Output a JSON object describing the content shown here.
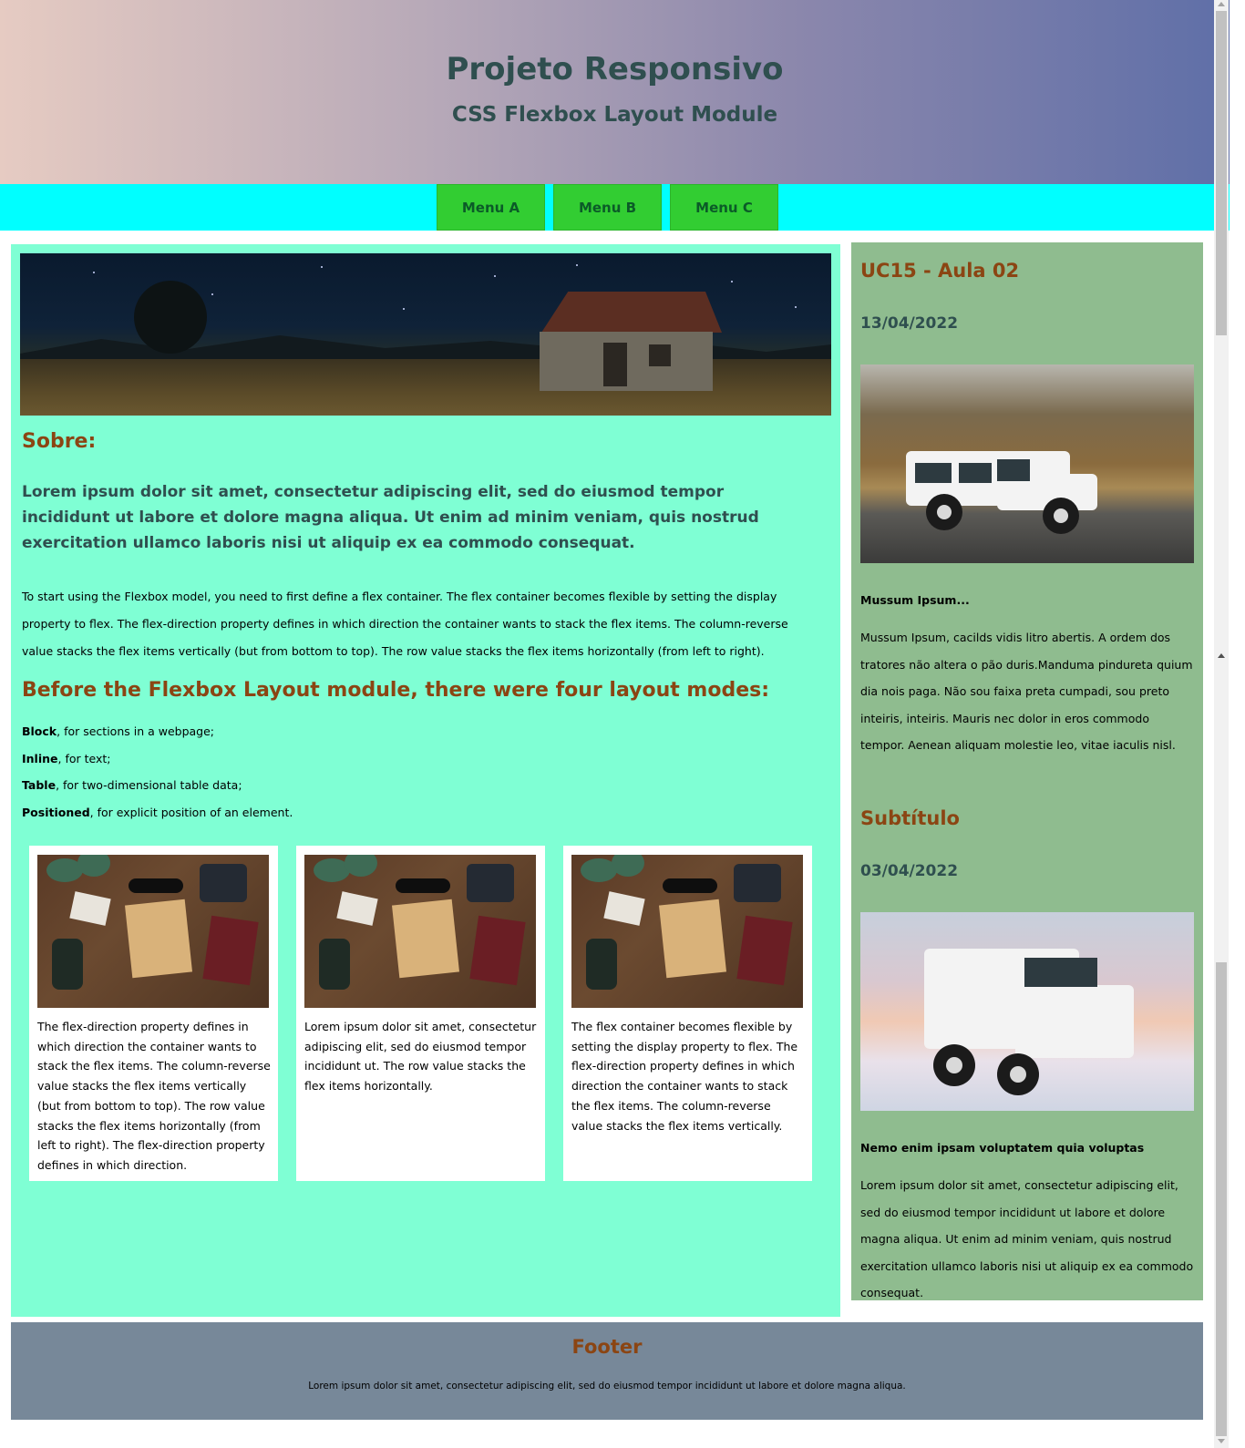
{
  "header": {
    "title": "Projeto Responsivo",
    "subtitle": "CSS Flexbox Layout Module"
  },
  "nav": {
    "items": [
      {
        "label": "Menu A"
      },
      {
        "label": "Menu B"
      },
      {
        "label": "Menu C"
      }
    ]
  },
  "main": {
    "about_heading": "Sobre:",
    "lead": "Lorem ipsum dolor sit amet, consectetur adipiscing elit, sed do eiusmod tempor incididunt ut labore et dolore magna aliqua. Ut enim ad minim veniam, quis nostrud exercitation ullamco laboris nisi ut aliquip ex ea commodo consequat.",
    "body": "To start using the Flexbox model, you need to first define a flex container. The flex container becomes flexible by setting the display property to flex. The flex-direction property defines in which direction the container wants to stack the flex items. The column-reverse value stacks the flex items vertically (but from bottom to top). The row value stacks the flex items horizontally (from left to right).",
    "modes_heading": "Before the Flexbox Layout module, there were four layout modes:",
    "modes": [
      {
        "term": "Block",
        "desc": ", for sections in a webpage;"
      },
      {
        "term": "Inline",
        "desc": ", for text;"
      },
      {
        "term": "Table",
        "desc": ", for two-dimensional table data;"
      },
      {
        "term": "Positioned",
        "desc": ", for explicit position of an element."
      }
    ],
    "cards": [
      {
        "text": "The flex-direction property defines in which direction the container wants to stack the flex items. The column-reverse value stacks the flex items vertically (but from bottom to top). The row value stacks the flex items horizontally (from left to right). The flex-direction property defines in which direction."
      },
      {
        "text": "Lorem ipsum dolor sit amet, consectetur adipiscing elit, sed do eiusmod tempor incididunt ut. The row value stacks the flex items horizontally."
      },
      {
        "text": "The flex container becomes flexible by setting the display property to flex. The flex-direction property defines in which direction the container wants to stack the flex items. The column-reverse value stacks the flex items vertically."
      }
    ]
  },
  "aside": {
    "posts": [
      {
        "heading": "UC15 - Aula 02",
        "date": "13/04/2022",
        "caption": "Mussum Ipsum...",
        "text": "Mussum Ipsum, cacilds vidis litro abertis. A ordem dos tratores não altera o pão duris.Manduma pindureta quium dia nois paga. Não sou faixa preta cumpadi, sou preto inteiris, inteiris. Mauris nec dolor in eros commodo tempor. Aenean aliquam molestie leo, vitae iaculis nisl."
      },
      {
        "heading": "Subtítulo",
        "date": "03/04/2022",
        "caption": "Nemo enim ipsam voluptatem quia voluptas",
        "text": "Lorem ipsum dolor sit amet, consectetur adipiscing elit, sed do eiusmod tempor incididunt ut labore et dolore magna aliqua. Ut enim ad minim veniam, quis nostrud exercitation ullamco laboris nisi ut aliquip ex ea commodo consequat."
      }
    ]
  },
  "footer": {
    "title": "Footer",
    "text": "Lorem ipsum dolor sit amet, consectetur adipiscing elit, sed do eiusmod tempor incididunt ut labore et dolore magna aliqua."
  },
  "colors": {
    "header_gradient_start": "#e6cbc2",
    "header_gradient_end": "#5f6fa8",
    "nav_bg": "#00ffff",
    "menu_bg": "#32cd32",
    "main_bg": "#7fffd4",
    "aside_bg": "#8fbc8f",
    "footer_bg": "#778899",
    "heading_color": "#8b4513",
    "title_color": "#2f4f4f"
  }
}
